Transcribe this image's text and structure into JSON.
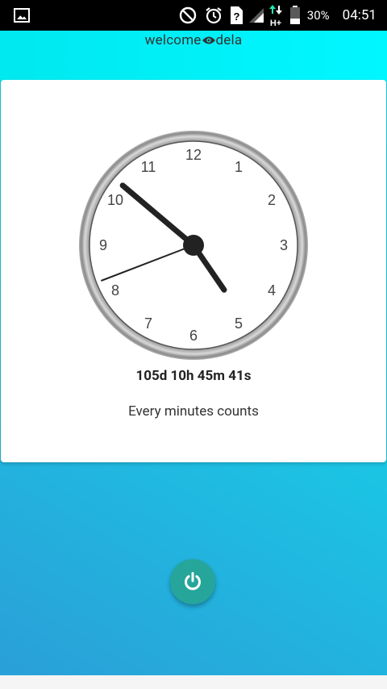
{
  "status_bar": {
    "battery_percent": "30%",
    "time": "04:51",
    "network_type": "H+"
  },
  "header": {
    "title_prefix": "welcome",
    "title_suffix": "dela"
  },
  "clock": {
    "numbers": [
      "12",
      "1",
      "2",
      "3",
      "4",
      "5",
      "6",
      "7",
      "8",
      "9",
      "10",
      "11"
    ],
    "time_shown": {
      "hour": 4,
      "minute": 51,
      "second": 41.5
    }
  },
  "card": {
    "countdown": "105d 10h 45m 41s",
    "motto": "Every minutes counts"
  },
  "colors": {
    "header": "#00f0f8",
    "background_start": "#2a9fd8",
    "background_end": "#13d4e9",
    "fab": "#26a69a"
  },
  "icons": [
    "gallery-icon",
    "do-not-disturb-icon",
    "alarm-icon",
    "sim-unknown-icon",
    "signal-icon",
    "data-arrows-icon",
    "battery-icon",
    "eye-icon",
    "power-icon"
  ]
}
